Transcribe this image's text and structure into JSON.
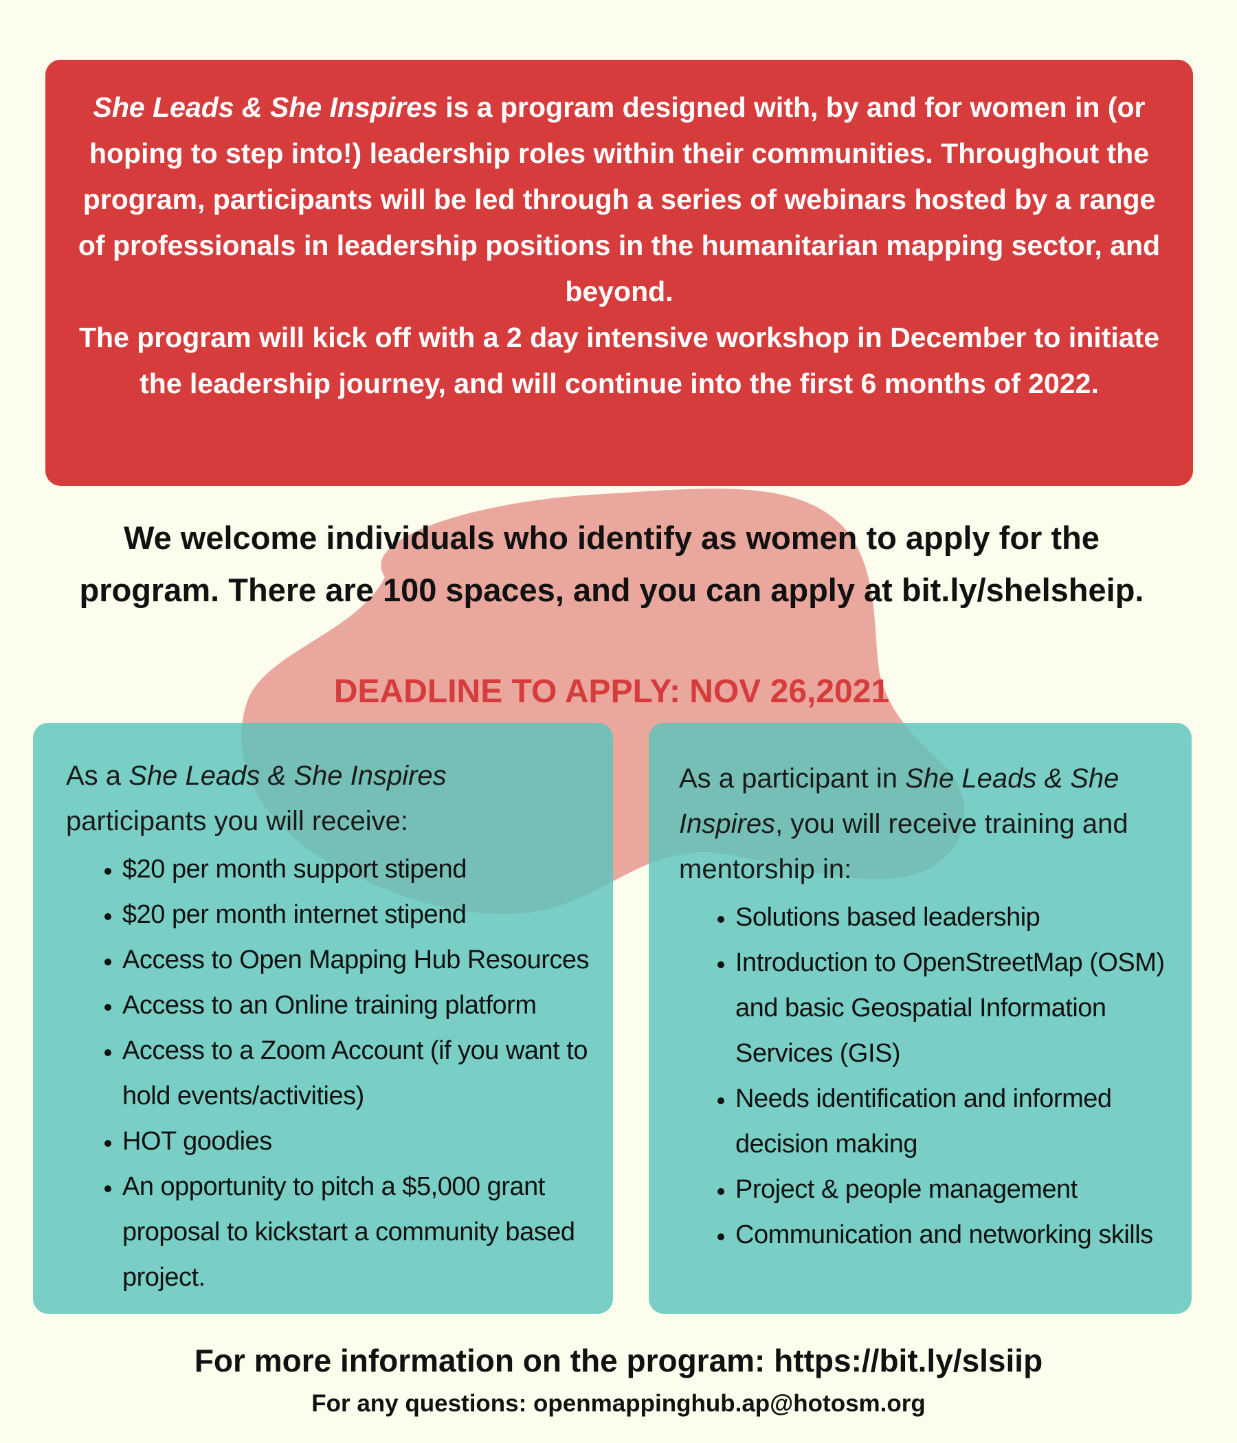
{
  "colors": {
    "background": "#fdfdee",
    "intro_box": "#d63c3c",
    "deadline_text": "#d63c3c",
    "cards": "#5cc4bc",
    "blob": "#eaa79e"
  },
  "intro": {
    "program_name": "She Leads & She Inspires",
    "paragraph_1_rest": " is a program designed with, by and for women in (or hoping to step into!) leadership roles within their communities. Throughout the program, participants will be led through a series of webinars hosted by a range of professionals in leadership positions in the humanitarian mapping sector, and beyond.",
    "paragraph_2": "The program will kick off with a 2 day intensive workshop in December to initiate the leadership journey, and will continue into the first 6 months of 2022."
  },
  "welcome": {
    "text": "We welcome individuals who identify as women to apply for the program. There are 100 spaces, and you can apply at bit.ly/shelsheip."
  },
  "deadline": {
    "text": "DEADLINE TO APPLY: NOV 26,2021"
  },
  "benefits_card": {
    "intro_prefix": "As a ",
    "intro_program": "She Leads & She Inspires",
    "intro_suffix": " participants you will receive:",
    "items": [
      "$20 per month support stipend",
      "$20 per month internet stipend",
      "Access to Open Mapping Hub Resources",
      "Access to an Online training platform",
      "Access to a Zoom Account (if you want to hold events/activities)",
      "HOT goodies",
      "An opportunity to pitch a $5,000 grant proposal to kickstart a community based project."
    ]
  },
  "training_card": {
    "intro_prefix": "As a participant in ",
    "intro_program": "She Leads & She Inspires",
    "intro_suffix": ", you will receive training and mentorship in:",
    "items": [
      "Solutions based leadership",
      "Introduction to OpenStreetMap (OSM) and basic Geospatial Information Services (GIS)",
      "Needs identification and informed decision making",
      "Project & people management",
      "Communication and networking skills"
    ]
  },
  "footer": {
    "more_info": "For more information on the program: https://bit.ly/slsiip",
    "questions": "For any questions: openmappinghub.ap@hotosm.org"
  }
}
